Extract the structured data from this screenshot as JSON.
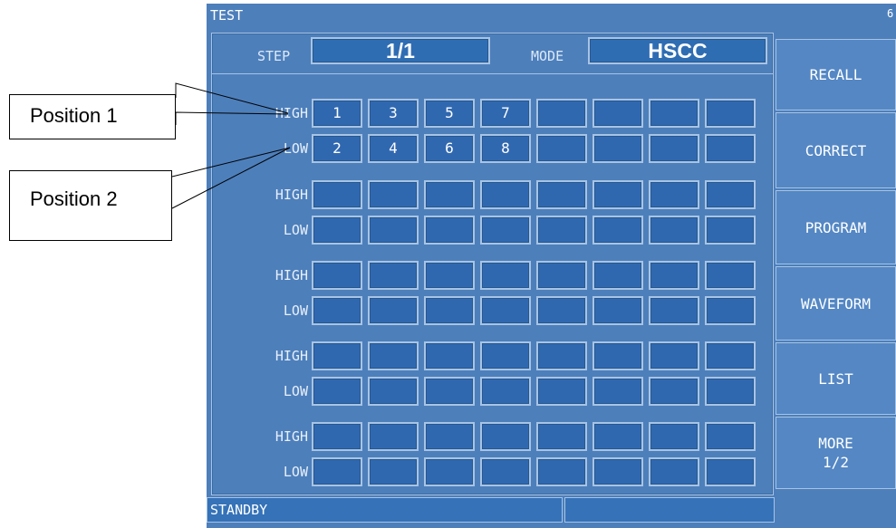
{
  "window": {
    "title": "TEST",
    "corner_glyph": "6"
  },
  "header": {
    "step_label": "STEP",
    "step_value": "1/1",
    "mode_label": "MODE",
    "mode_value": "HSCC"
  },
  "grid": {
    "rows": [
      {
        "label": "HIGH",
        "cells": [
          "1",
          "3",
          "5",
          "7",
          "",
          "",
          "",
          ""
        ]
      },
      {
        "label": "LOW",
        "cells": [
          "2",
          "4",
          "6",
          "8",
          "",
          "",
          "",
          ""
        ]
      },
      {
        "label": "HIGH",
        "cells": [
          "",
          "",
          "",
          "",
          "",
          "",
          "",
          ""
        ]
      },
      {
        "label": "LOW",
        "cells": [
          "",
          "",
          "",
          "",
          "",
          "",
          "",
          ""
        ]
      },
      {
        "label": "HIGH",
        "cells": [
          "",
          "",
          "",
          "",
          "",
          "",
          "",
          ""
        ]
      },
      {
        "label": "LOW",
        "cells": [
          "",
          "",
          "",
          "",
          "",
          "",
          "",
          ""
        ]
      },
      {
        "label": "HIGH",
        "cells": [
          "",
          "",
          "",
          "",
          "",
          "",
          "",
          ""
        ]
      },
      {
        "label": "LOW",
        "cells": [
          "",
          "",
          "",
          "",
          "",
          "",
          "",
          ""
        ]
      },
      {
        "label": "HIGH",
        "cells": [
          "",
          "",
          "",
          "",
          "",
          "",
          "",
          ""
        ]
      },
      {
        "label": "LOW",
        "cells": [
          "",
          "",
          "",
          "",
          "",
          "",
          "",
          ""
        ]
      }
    ]
  },
  "softkeys": [
    {
      "name": "recall",
      "line1": "RECALL",
      "line2": ""
    },
    {
      "name": "correct",
      "line1": "CORRECT",
      "line2": ""
    },
    {
      "name": "program",
      "line1": "PROGRAM",
      "line2": ""
    },
    {
      "name": "waveform",
      "line1": "WAVEFORM",
      "line2": ""
    },
    {
      "name": "list",
      "line1": "LIST",
      "line2": ""
    },
    {
      "name": "more",
      "line1": "MORE",
      "line2": "1/2"
    }
  ],
  "status": {
    "left": "STANDBY",
    "right": ""
  },
  "callouts": {
    "position1": "Position 1",
    "position2": "Position 2"
  },
  "colors": {
    "screen_bg": "#4d7fbb",
    "cell_fill": "#3068b0",
    "cell_border": "#a8c4e4",
    "text": "#ffffff"
  }
}
